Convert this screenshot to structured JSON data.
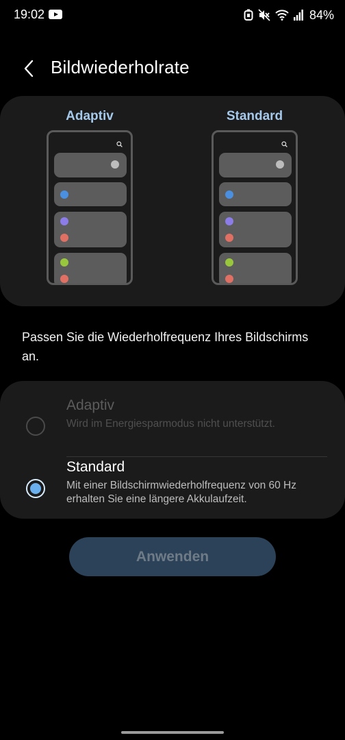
{
  "status_bar": {
    "time": "19:02",
    "notification_icon": "youtube-icon",
    "icons": [
      "alarm-icon",
      "mute-icon",
      "wifi-icon",
      "signal-icon"
    ],
    "battery": "84%"
  },
  "header": {
    "back_icon": "chevron-left-icon",
    "title": "Bildwiederholrate"
  },
  "preview": {
    "left_label": "Adaptiv",
    "right_label": "Standard",
    "dot_colors": [
      "#bdbdbd",
      "#4a8fe0",
      "#8b7ce8",
      "#e17064",
      "#98c63d",
      "#e17064"
    ],
    "accent_color": "#a5c9eb"
  },
  "description": "Passen Sie die Wiederholfrequenz Ihres Bildschirms an.",
  "options": [
    {
      "title": "Adaptiv",
      "subtitle": "Wird im Energiesparmodus nicht unterstützt.",
      "selected": false,
      "enabled": false
    },
    {
      "title": "Standard",
      "subtitle": "Mit einer Bildschirmwiederholfrequenz von 60 Hz erhalten Sie eine längere Akkulaufzeit.",
      "selected": true,
      "enabled": true
    }
  ],
  "apply_button": {
    "label": "Anwenden",
    "enabled": false
  },
  "colors": {
    "background": "#000000",
    "card": "#1b1b1b",
    "radio_selected": "#6ab0ee",
    "button_disabled": "#2c4258"
  }
}
